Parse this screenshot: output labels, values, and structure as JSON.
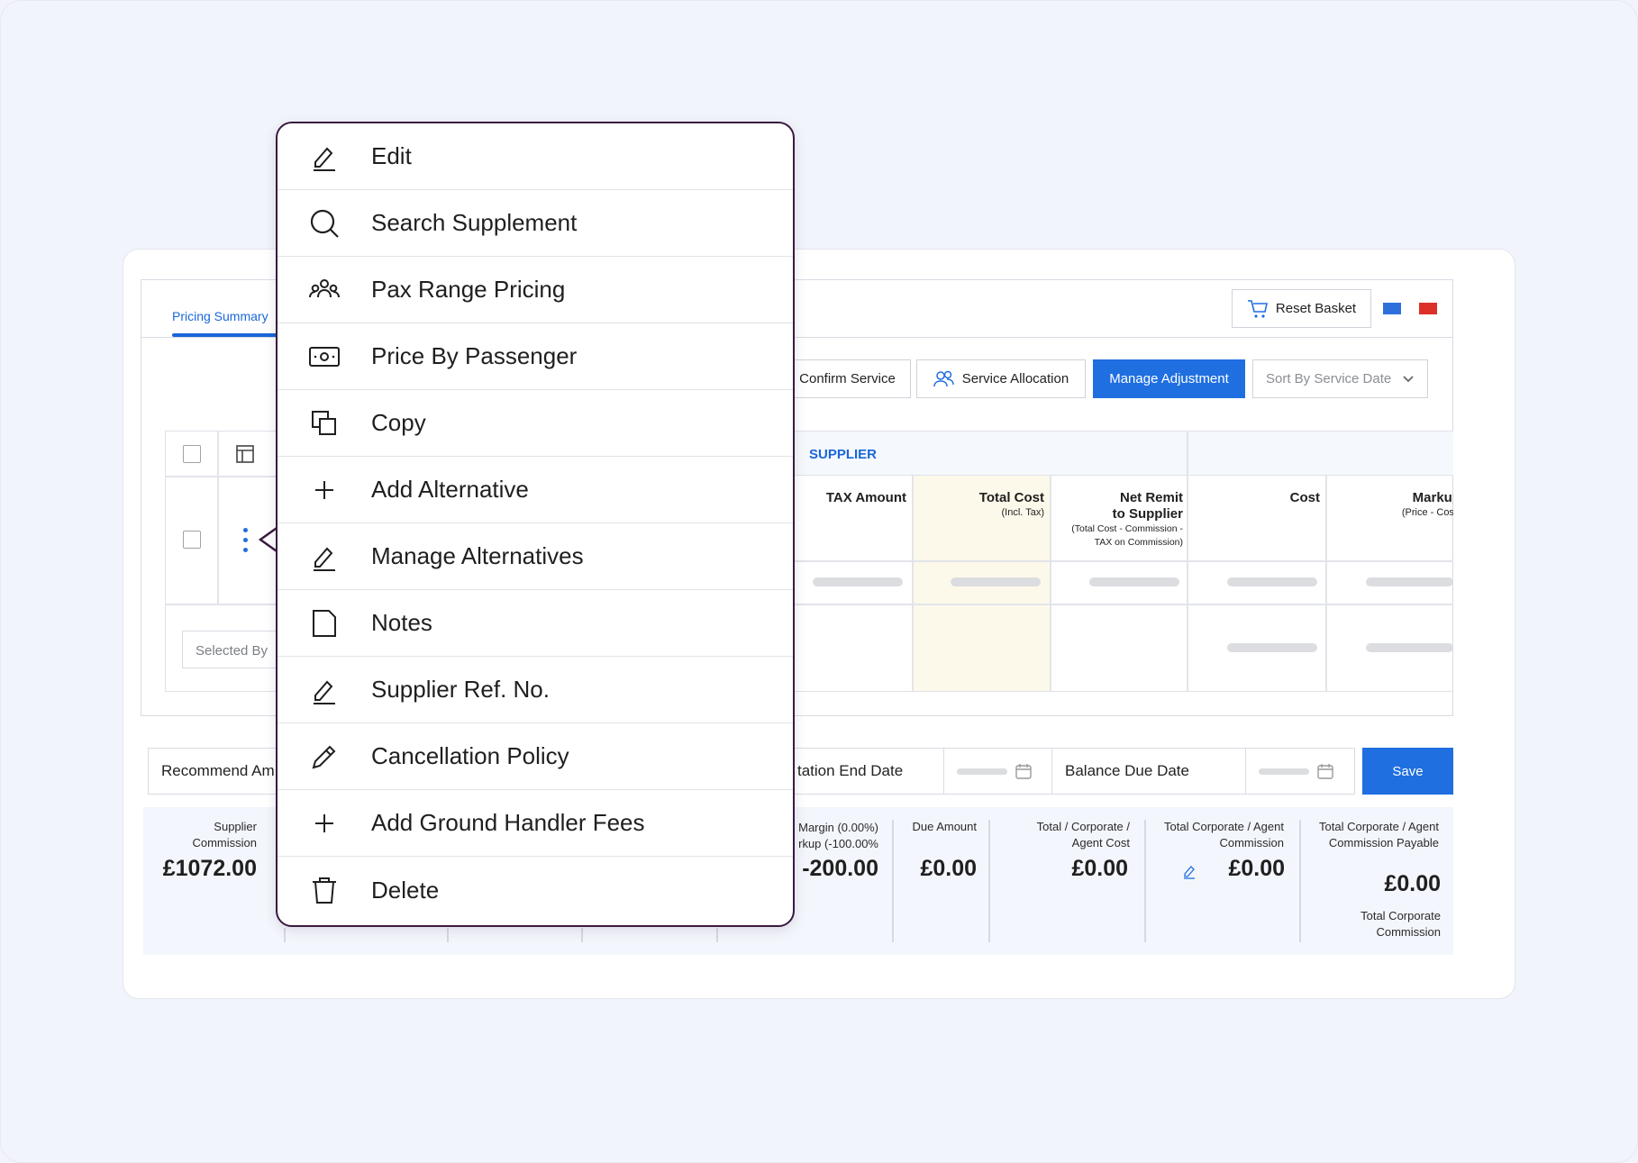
{
  "tabs": {
    "active": "Pricing Summary"
  },
  "toolbar": {
    "reset_basket": "Reset Basket",
    "confirm_service": "Confirm Service",
    "service_allocation": "Service Allocation",
    "manage_adjustment": "Manage Adjustment",
    "sort_by": "Sort By Service Date"
  },
  "colors": {
    "accent": "#1f6fe0",
    "flag_blue": "#2f6fdc",
    "flag_red": "#dc3028",
    "menu_border": "#3a1a3f"
  },
  "table": {
    "group_label": "SUPPLIER",
    "columns": [
      {
        "title": "TAX Amount",
        "sub": ""
      },
      {
        "title": "Total Cost",
        "sub": "(Incl. Tax)"
      },
      {
        "title": "Net Remit to Supplier",
        "sub": "(Total Cost - Commission - TAX on Commission)"
      },
      {
        "title": "Cost",
        "sub": ""
      },
      {
        "title": "Markup",
        "sub": "(Price - Cost"
      }
    ],
    "selected_by_placeholder": "Selected By"
  },
  "fields": {
    "recommend": "Recommend Am",
    "quotation_end": "tation End Date",
    "balance_due": "Balance Due Date",
    "save": "Save"
  },
  "summary": {
    "supplier_commission_label": "Supplier Commission",
    "supplier_commission_value": "£1072.00",
    "margin_label1": "Margin (0.00%)",
    "margin_label2": "rkup (-100.00%",
    "margin_value": "-200.00",
    "due_amount_label": "Due Amount",
    "due_amount_value": "£0.00",
    "agent_cost_label": "Total / Corporate / Agent Cost",
    "agent_cost_value": "£0.00",
    "agent_commission_label": "Total Corporate / Agent Commission",
    "agent_commission_value": "£0.00",
    "commission_payable_label": "Total Corporate / Agent Commission Payable",
    "commission_payable_value": "£0.00",
    "corporate_commission_label": "Total Corporate Commission"
  },
  "menu": {
    "items": [
      {
        "label": "Edit",
        "icon": "edit-icon"
      },
      {
        "label": "Search Supplement",
        "icon": "search-icon"
      },
      {
        "label": "Pax Range Pricing",
        "icon": "group-icon"
      },
      {
        "label": "Price By Passenger",
        "icon": "money-icon"
      },
      {
        "label": "Copy",
        "icon": "copy-icon"
      },
      {
        "label": "Add Alternative",
        "icon": "plus-icon"
      },
      {
        "label": "Manage Alternatives",
        "icon": "edit-icon"
      },
      {
        "label": "Notes",
        "icon": "note-icon"
      },
      {
        "label": "Supplier Ref. No.",
        "icon": "edit-icon"
      },
      {
        "label": "Cancellation Policy",
        "icon": "pencil-icon"
      },
      {
        "label": "Add Ground Handler Fees",
        "icon": "plus-icon"
      },
      {
        "label": "Delete",
        "icon": "trash-icon"
      }
    ]
  }
}
